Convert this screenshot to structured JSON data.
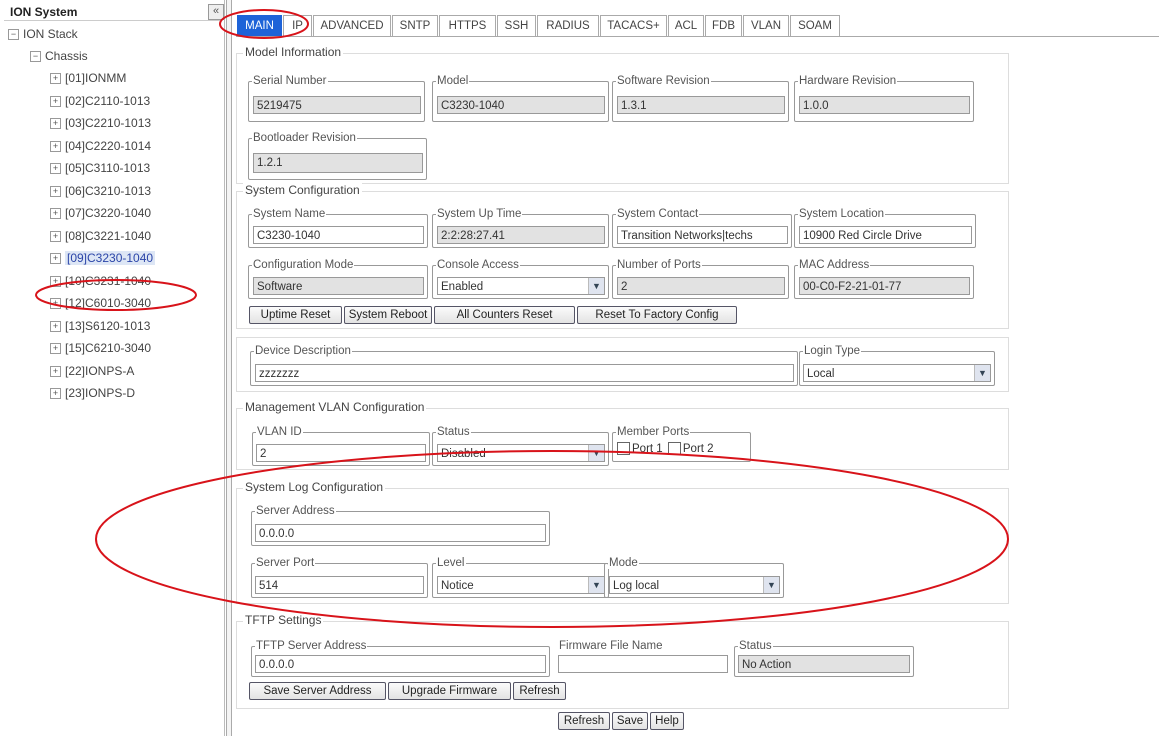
{
  "left_panel": {
    "title": "ION System",
    "collapse_glyph": "«",
    "tree": {
      "root": "ION Stack",
      "chassis": "Chassis",
      "items": [
        "[01]IONMM",
        "[02]C2110-1013",
        "[03]C2210-1013",
        "[04]C2220-1014",
        "[05]C3110-1013",
        "[06]C3210-1013",
        "[07]C3220-1040",
        "[08]C3221-1040",
        "[09]C3230-1040",
        "[10]C3231-1040",
        "[12]C6010-3040",
        "[13]S6120-1013",
        "[15]C6210-3040",
        "[22]IONPS-A",
        "[23]IONPS-D"
      ],
      "selected_index": 8
    }
  },
  "tabs": [
    "MAIN",
    "IP",
    "ADVANCED",
    "SNTP",
    "HTTPS",
    "SSH",
    "RADIUS",
    "TACACS+",
    "ACL",
    "FDB",
    "VLAN",
    "SOAM"
  ],
  "active_tab": "MAIN",
  "model_info": {
    "title": "Model Information",
    "serial_label": "Serial Number",
    "serial": "5219475",
    "model_label": "Model",
    "model": "C3230-1040",
    "sw_label": "Software Revision",
    "sw": "1.3.1",
    "hw_label": "Hardware Revision",
    "hw": "1.0.0",
    "boot_label": "Bootloader Revision",
    "boot": "1.2.1"
  },
  "system_config": {
    "title": "System Configuration",
    "name_label": "System Name",
    "name": "C3230-1040",
    "uptime_label": "System Up Time",
    "uptime": "2:2:28:27.41",
    "contact_label": "System Contact",
    "contact": "Transition Networks|techs",
    "location_label": "System Location",
    "location": "10900 Red Circle Drive",
    "cfgmode_label": "Configuration Mode",
    "cfgmode": "Software",
    "console_label": "Console Access",
    "console": "Enabled",
    "ports_label": "Number of Ports",
    "ports": "2",
    "mac_label": "MAC Address",
    "mac": "00-C0-F2-21-01-77",
    "buttons": [
      "Uptime Reset",
      "System Reboot",
      "All Counters Reset",
      "Reset To Factory Config"
    ]
  },
  "device": {
    "desc_label": "Device Description",
    "desc": "zzzzzzz",
    "login_label": "Login Type",
    "login": "Local"
  },
  "mgmt_vlan": {
    "title": "Management VLAN Configuration",
    "vlan_label": "VLAN ID",
    "vlan": "2",
    "status_label": "Status",
    "status": "Disabled",
    "member_label": "Member Ports",
    "port1": "Port 1",
    "port2": "Port 2"
  },
  "syslog": {
    "title": "System Log Configuration",
    "server_label": "Server Address",
    "server": "0.0.0.0",
    "port_label": "Server Port",
    "port": "514",
    "level_label": "Level",
    "level": "Notice",
    "mode_label": "Mode",
    "mode": "Log local"
  },
  "tftp": {
    "title": "TFTP Settings",
    "server_label": "TFTP Server Address",
    "server": "0.0.0.0",
    "file_label": "Firmware File Name",
    "file": "",
    "status_label": "Status",
    "status": "No Action",
    "buttons": [
      "Save Server Address",
      "Upgrade Firmware",
      "Refresh"
    ]
  },
  "footer_buttons": [
    "Refresh",
    "Save",
    "Help"
  ],
  "colors": {
    "active_tab": "#1e63d8",
    "annotation_red": "#d8131a",
    "readonly_field": "#e2e2e2"
  },
  "icons": {
    "expand": "plus-icon",
    "collapse": "minus-icon",
    "select": "dropdown-arrow-icon"
  }
}
